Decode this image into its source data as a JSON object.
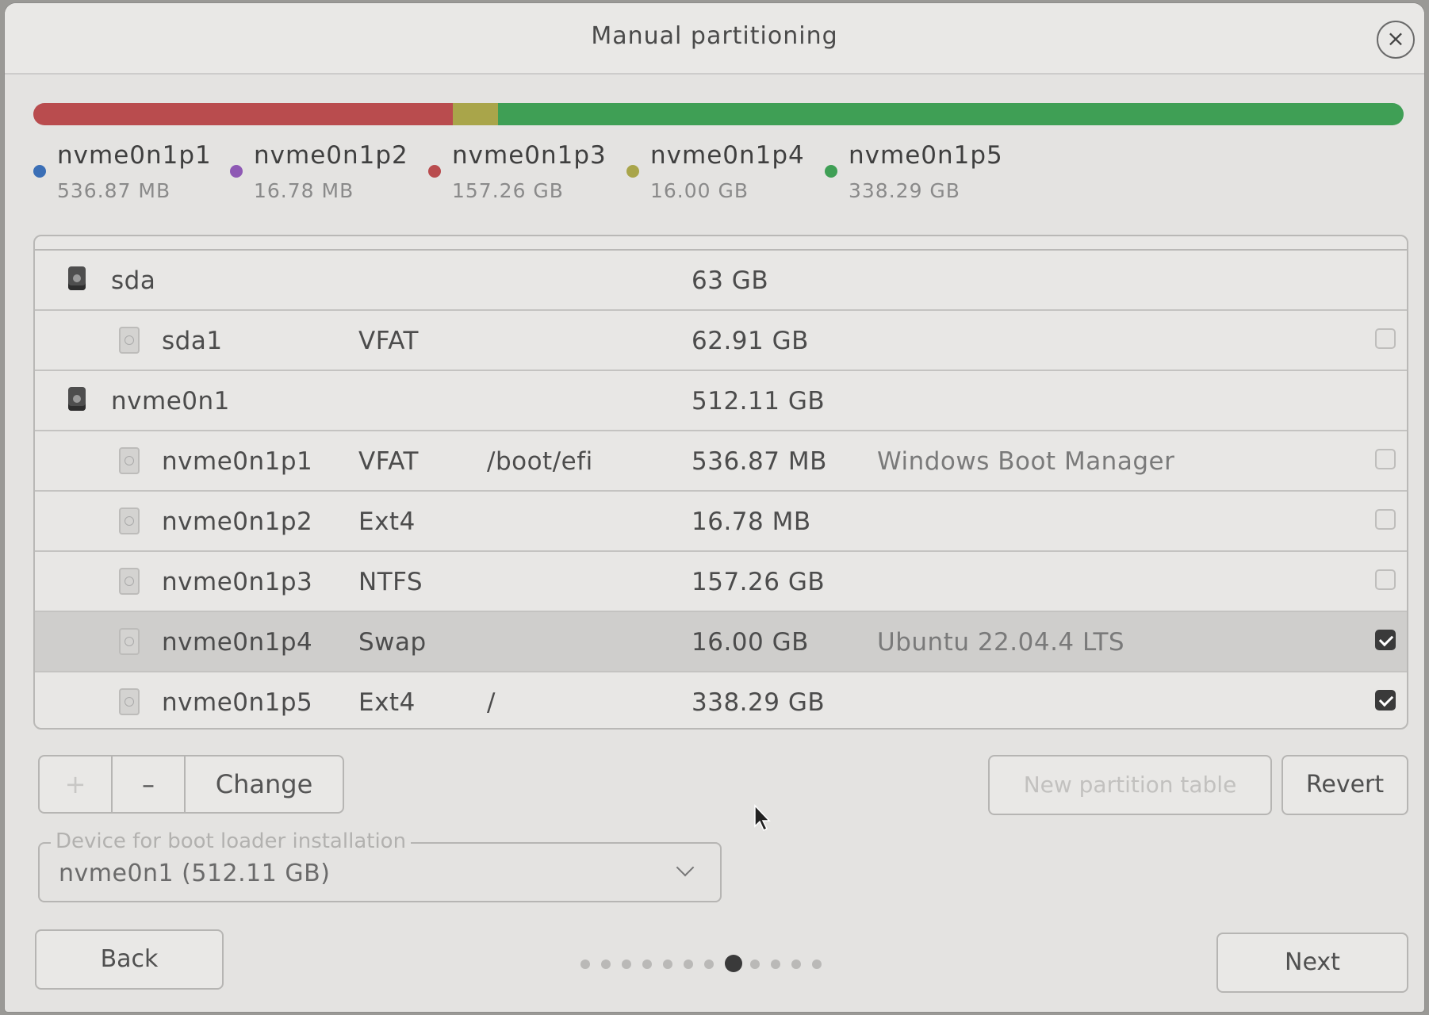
{
  "window": {
    "title": "Manual partitioning"
  },
  "partition_bar": {
    "segments": [
      {
        "name": "nvme0n1p1",
        "fraction": 0.001,
        "color": "#3b6fb6"
      },
      {
        "name": "nvme0n1p2",
        "fraction": 0.0001,
        "color": "#8e59b4"
      },
      {
        "name": "nvme0n1p3",
        "fraction": 0.307,
        "color": "#b94c4e"
      },
      {
        "name": "nvme0n1p4",
        "fraction": 0.033,
        "color": "#a9a54a"
      },
      {
        "name": "nvme0n1p5",
        "fraction": 0.659,
        "color": "#3f9f55"
      }
    ]
  },
  "legend": [
    {
      "name": "nvme0n1p1",
      "size": "536.87 MB",
      "color": "#3b6fb6"
    },
    {
      "name": "nvme0n1p2",
      "size": "16.78 MB",
      "color": "#8e59b4"
    },
    {
      "name": "nvme0n1p3",
      "size": "157.26 GB",
      "color": "#b94c4e"
    },
    {
      "name": "nvme0n1p4",
      "size": "16.00 GB",
      "color": "#a9a54a"
    },
    {
      "name": "nvme0n1p5",
      "size": "338.29 GB",
      "color": "#3f9f55"
    }
  ],
  "table": {
    "rows": [
      {
        "name": "sda",
        "type": "",
        "mount": "",
        "size": "63 GB",
        "system": "",
        "disk": true
      },
      {
        "name": "sda1",
        "type": "VFAT",
        "mount": "",
        "size": "62.91 GB",
        "system": "",
        "checked": false
      },
      {
        "name": "nvme0n1",
        "type": "",
        "mount": "",
        "size": "512.11 GB",
        "system": "",
        "disk": true
      },
      {
        "name": "nvme0n1p1",
        "type": "VFAT",
        "mount": "/boot/efi",
        "size": "536.87 MB",
        "system": "Windows Boot Manager",
        "checked": false
      },
      {
        "name": "nvme0n1p2",
        "type": "Ext4",
        "mount": "",
        "size": "16.78 MB",
        "system": "",
        "checked": false
      },
      {
        "name": "nvme0n1p3",
        "type": "NTFS",
        "mount": "",
        "size": "157.26 GB",
        "system": "",
        "checked": false
      },
      {
        "name": "nvme0n1p4",
        "type": "Swap",
        "mount": "",
        "size": "16.00 GB",
        "system": "Ubuntu 22.04.4 LTS",
        "checked": true,
        "selected": true
      },
      {
        "name": "nvme0n1p5",
        "type": "Ext4",
        "mount": "/",
        "size": "338.29 GB",
        "system": "",
        "checked": true
      }
    ]
  },
  "toolbar": {
    "add_label": "+",
    "remove_label": "–",
    "change_label": "Change",
    "new_table_label": "New partition table",
    "revert_label": "Revert"
  },
  "bootloader": {
    "label": "Device for boot loader installation",
    "value": "nvme0n1  (512.11 GB)"
  },
  "nav": {
    "back_label": "Back",
    "next_label": "Next",
    "page_count": 12,
    "current_page": 8
  }
}
